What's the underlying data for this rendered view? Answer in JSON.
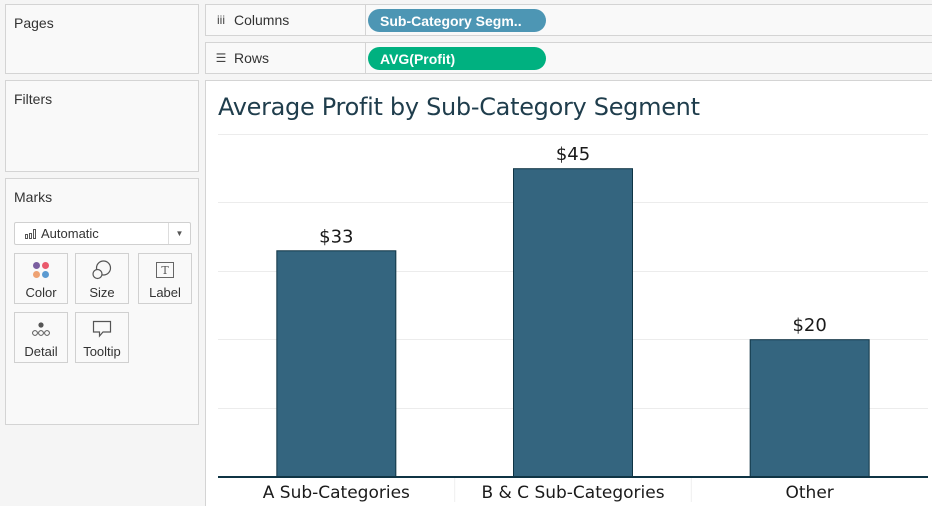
{
  "left_panel": {
    "pages_title": "Pages",
    "filters_title": "Filters",
    "marks_title": "Marks",
    "mark_type": "Automatic",
    "mark_buttons": [
      {
        "label": "Color",
        "icon": "color-dots-icon"
      },
      {
        "label": "Size",
        "icon": "size-circles-icon"
      },
      {
        "label": "Label",
        "icon": "label-text-icon"
      },
      {
        "label": "Detail",
        "icon": "detail-dots-icon"
      },
      {
        "label": "Tooltip",
        "icon": "tooltip-bubble-icon"
      }
    ]
  },
  "shelves": {
    "columns": {
      "label": "Columns",
      "pill": "Sub-Category Segm.."
    },
    "rows": {
      "label": "Rows",
      "pill": "AVG(Profit)"
    }
  },
  "colors": {
    "bar_fill": "#34657f",
    "bar_stroke": "#0f3444",
    "axis": "#0f3444",
    "dimension_pill": "#4d96b4",
    "measure_pill": "#00b180",
    "title": "#1f3d4c"
  },
  "chart_data": {
    "type": "bar",
    "title": "Average Profit by Sub-Category Segment",
    "categories": [
      "A Sub-Categories",
      "B & C Sub-Categories",
      "Other"
    ],
    "values": [
      33,
      45,
      20
    ],
    "data_labels": [
      "$33",
      "$45",
      "$20"
    ],
    "xlabel": "",
    "ylabel": "",
    "ylim": [
      0,
      50
    ],
    "gridlines": [
      10,
      20,
      30,
      40,
      50
    ],
    "grid": true,
    "y_axis_visible": false,
    "legend": "none"
  }
}
